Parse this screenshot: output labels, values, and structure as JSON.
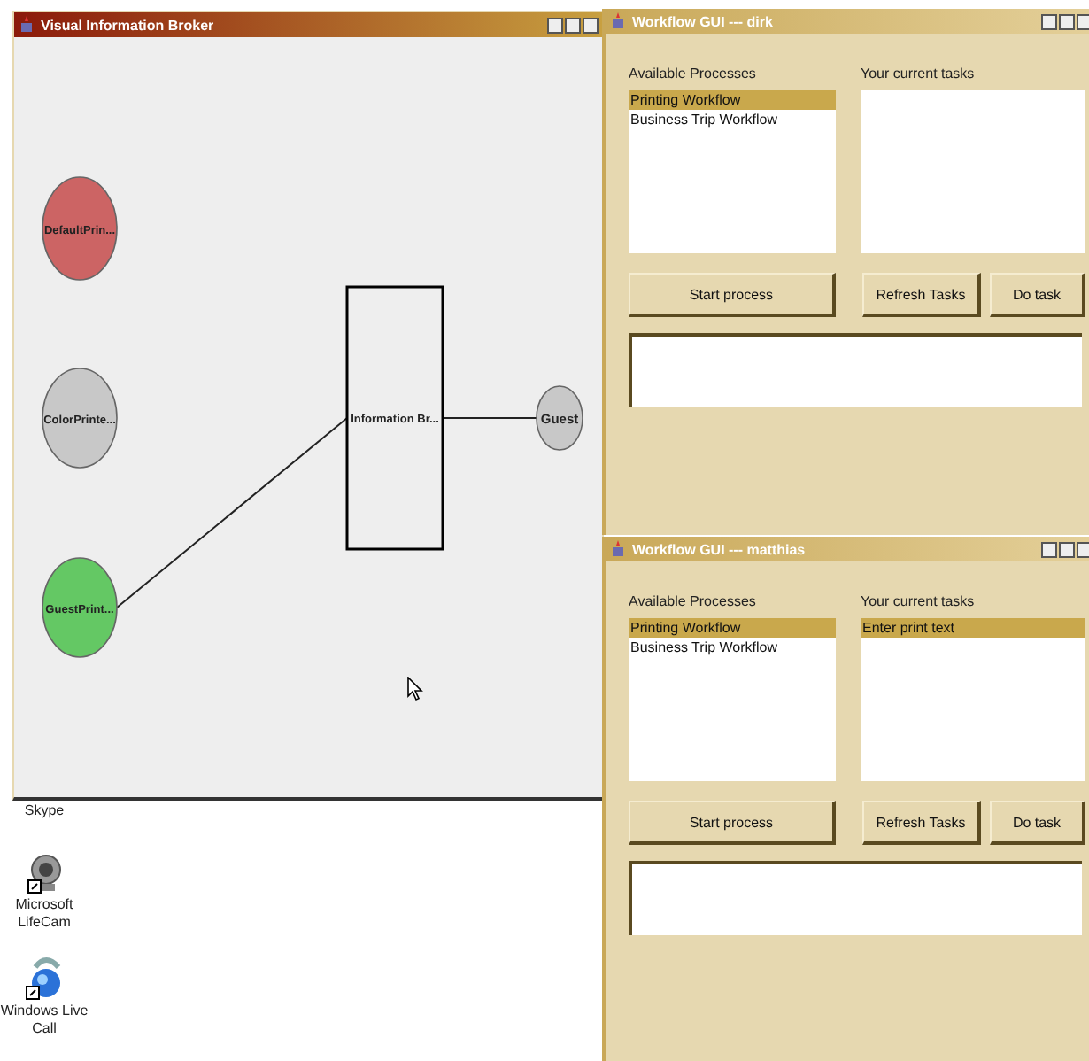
{
  "broker_window": {
    "title": "Visual Information Broker",
    "nodes": [
      {
        "kind": "circle",
        "label": "DefaultPrin...",
        "color": "#cc6464",
        "linked": false
      },
      {
        "kind": "circle",
        "label": "ColorPrinte...",
        "color": "#c8c8c8",
        "linked": false
      },
      {
        "kind": "circle",
        "label": "GuestPrint...",
        "color": "#64c864",
        "linked": true
      },
      {
        "kind": "box",
        "label": "Information Br..."
      },
      {
        "kind": "small_circle",
        "label": "Guest",
        "color": "#c8c8c8",
        "linked": true
      }
    ]
  },
  "desktop_icons": [
    {
      "label": "Skype"
    },
    {
      "kind": "webcam",
      "label": "Microsoft LifeCam"
    },
    {
      "kind": "phone",
      "label": "Windows Live Call"
    }
  ],
  "workflow_windows": [
    {
      "title": "Workflow GUI --- dirk",
      "processes_label": "Available Processes",
      "processes": [
        {
          "label": "Printing Workflow",
          "selected": true
        },
        {
          "label": "Business Trip Workflow",
          "selected": false
        }
      ],
      "tasks_label": "Your current tasks",
      "buttons": [
        "Start process",
        "Refresh Tasks",
        "Do task"
      ]
    },
    {
      "title": "Workflow GUI --- matthias",
      "processes_label": "Available Processes",
      "processes": [
        {
          "label": "Printing Workflow",
          "selected": true
        },
        {
          "label": "Business Trip Workflow",
          "selected": false
        }
      ],
      "tasks_label": "Your current tasks",
      "tasks": [
        {
          "label": "Enter print text",
          "selected": true
        }
      ],
      "buttons": [
        "Start process",
        "Refresh Tasks",
        "Do task"
      ]
    }
  ]
}
